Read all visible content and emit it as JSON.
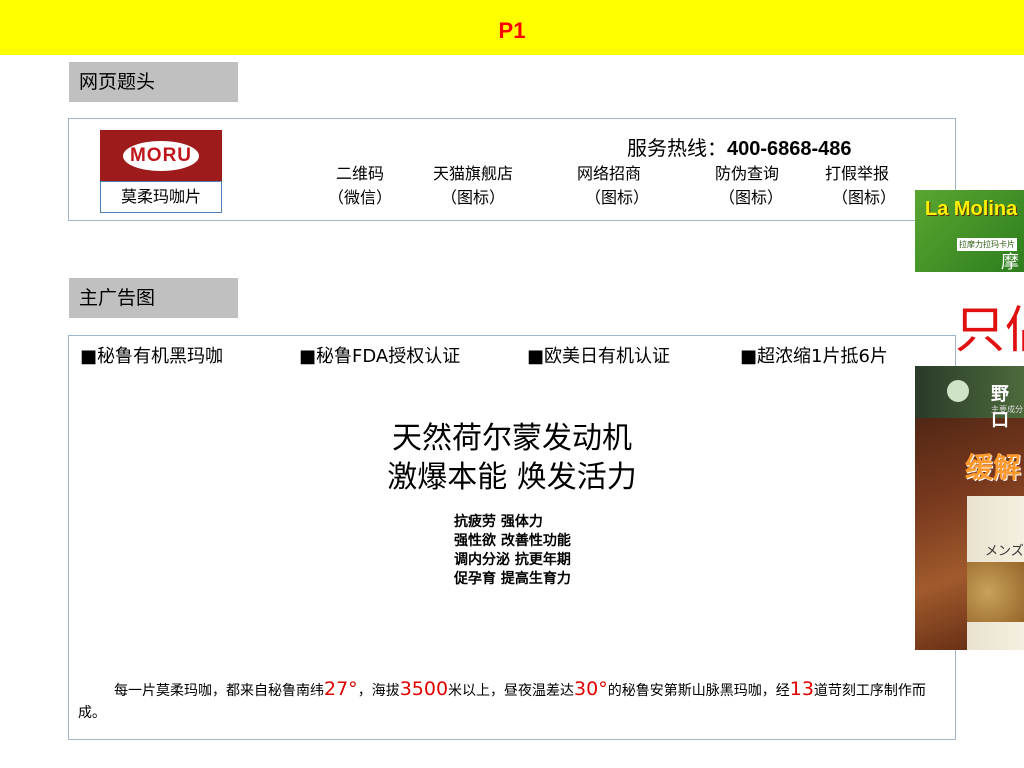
{
  "page": {
    "badge": "P1"
  },
  "sections": {
    "header_label": "网页题头",
    "banner_label": "主广告图"
  },
  "header": {
    "logo": {
      "brand": "MORU",
      "name": "莫柔玛咖片"
    },
    "hotline": {
      "label": "服务热线：",
      "number": "400-6868-486"
    },
    "nav": [
      {
        "line1": "二维码",
        "line2": "（微信）"
      },
      {
        "line1": "天猫旗舰店",
        "line2": "（图标）"
      },
      {
        "line1": "网络招商",
        "line2": "（图标）"
      },
      {
        "line1": "防伪查询",
        "line2": "（图标）"
      },
      {
        "line1": "打假举报",
        "line2": "（图标）"
      }
    ]
  },
  "banner": {
    "features": [
      "■秘鲁有机黑玛咖",
      "■秘鲁FDA授权认证",
      "■欧美日有机认证",
      "■超浓缩1片抵6片"
    ],
    "headline1": "天然荷尔蒙发动机",
    "headline2": "激爆本能  焕发活力",
    "benefits": [
      "抗疲劳   强体力",
      "强性欲   改善性功能",
      "调内分泌  抗更年期",
      "促孕育   提高生育力"
    ],
    "footer": {
      "t1": "每一片莫柔玛咖，都来自秘鲁南纬",
      "n1": "27°",
      "t2": "，海拔",
      "n2": "3500",
      "t3": "米以上，昼夜温差达",
      "n3": "30°",
      "t4": "的秘鲁安第斯山脉黑玛咖，经",
      "n4": "13",
      "t5": "道苛刻工序制作而成。"
    }
  },
  "side": {
    "lamolina_text": "La Molina",
    "lamolina_sub": "拉摩力拉玛卡片",
    "lamolina_extra": "摩",
    "red_text": "只侣",
    "product_brand": "野口",
    "product_small": "主要成分",
    "product_orange": "缓解",
    "product_box_text": "メンズ マ"
  },
  "colors": {
    "topbar": "#ffff00",
    "badge": "#ff0000",
    "label_bg": "#c0c0c0",
    "accent_red": "#e00000",
    "border": "#9fb6cd",
    "logo_red": "#9e1b1b"
  }
}
